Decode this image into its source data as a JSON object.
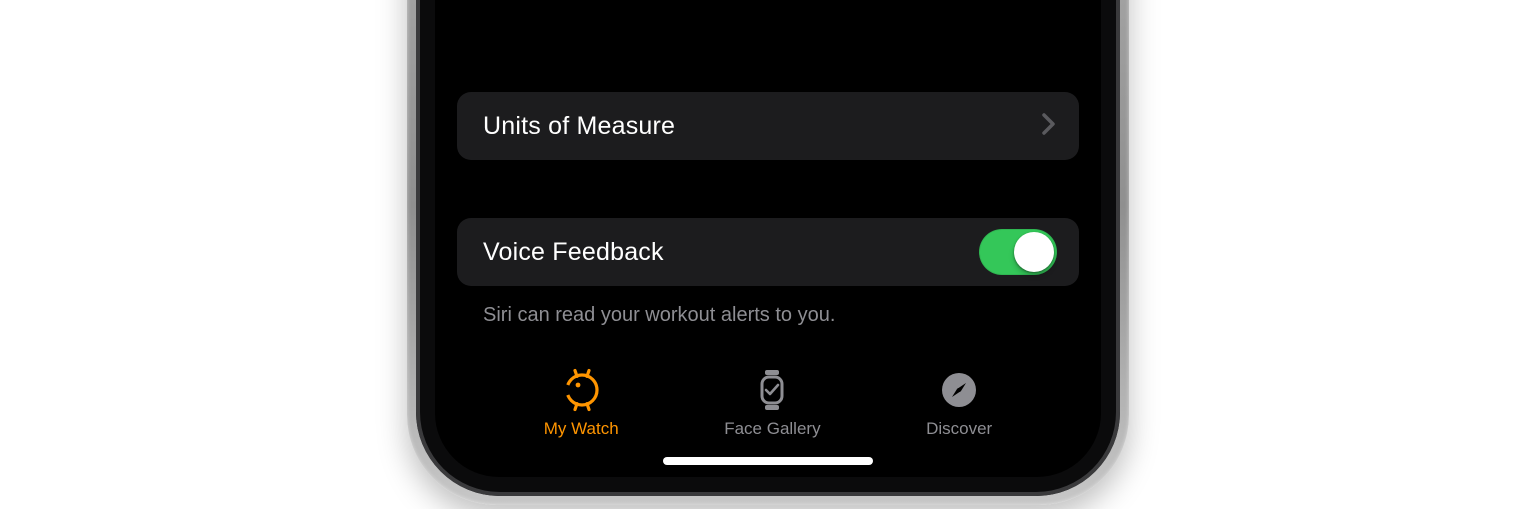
{
  "settings": {
    "units_row_label": "Units of Measure",
    "voice_feedback_label": "Voice Feedback",
    "voice_feedback_on": true,
    "footer_text": "Siri can read your workout alerts to you."
  },
  "tabbar": {
    "items": [
      {
        "label": "My Watch",
        "icon": "watch-icon",
        "active": true
      },
      {
        "label": "Face Gallery",
        "icon": "watch-face-icon",
        "active": false
      },
      {
        "label": "Discover",
        "icon": "compass-icon",
        "active": false
      }
    ]
  },
  "colors": {
    "accent": "#ff9500",
    "toggle_on": "#34c759",
    "row_bg": "#1c1c1e",
    "secondary_text": "#8e8e93"
  }
}
